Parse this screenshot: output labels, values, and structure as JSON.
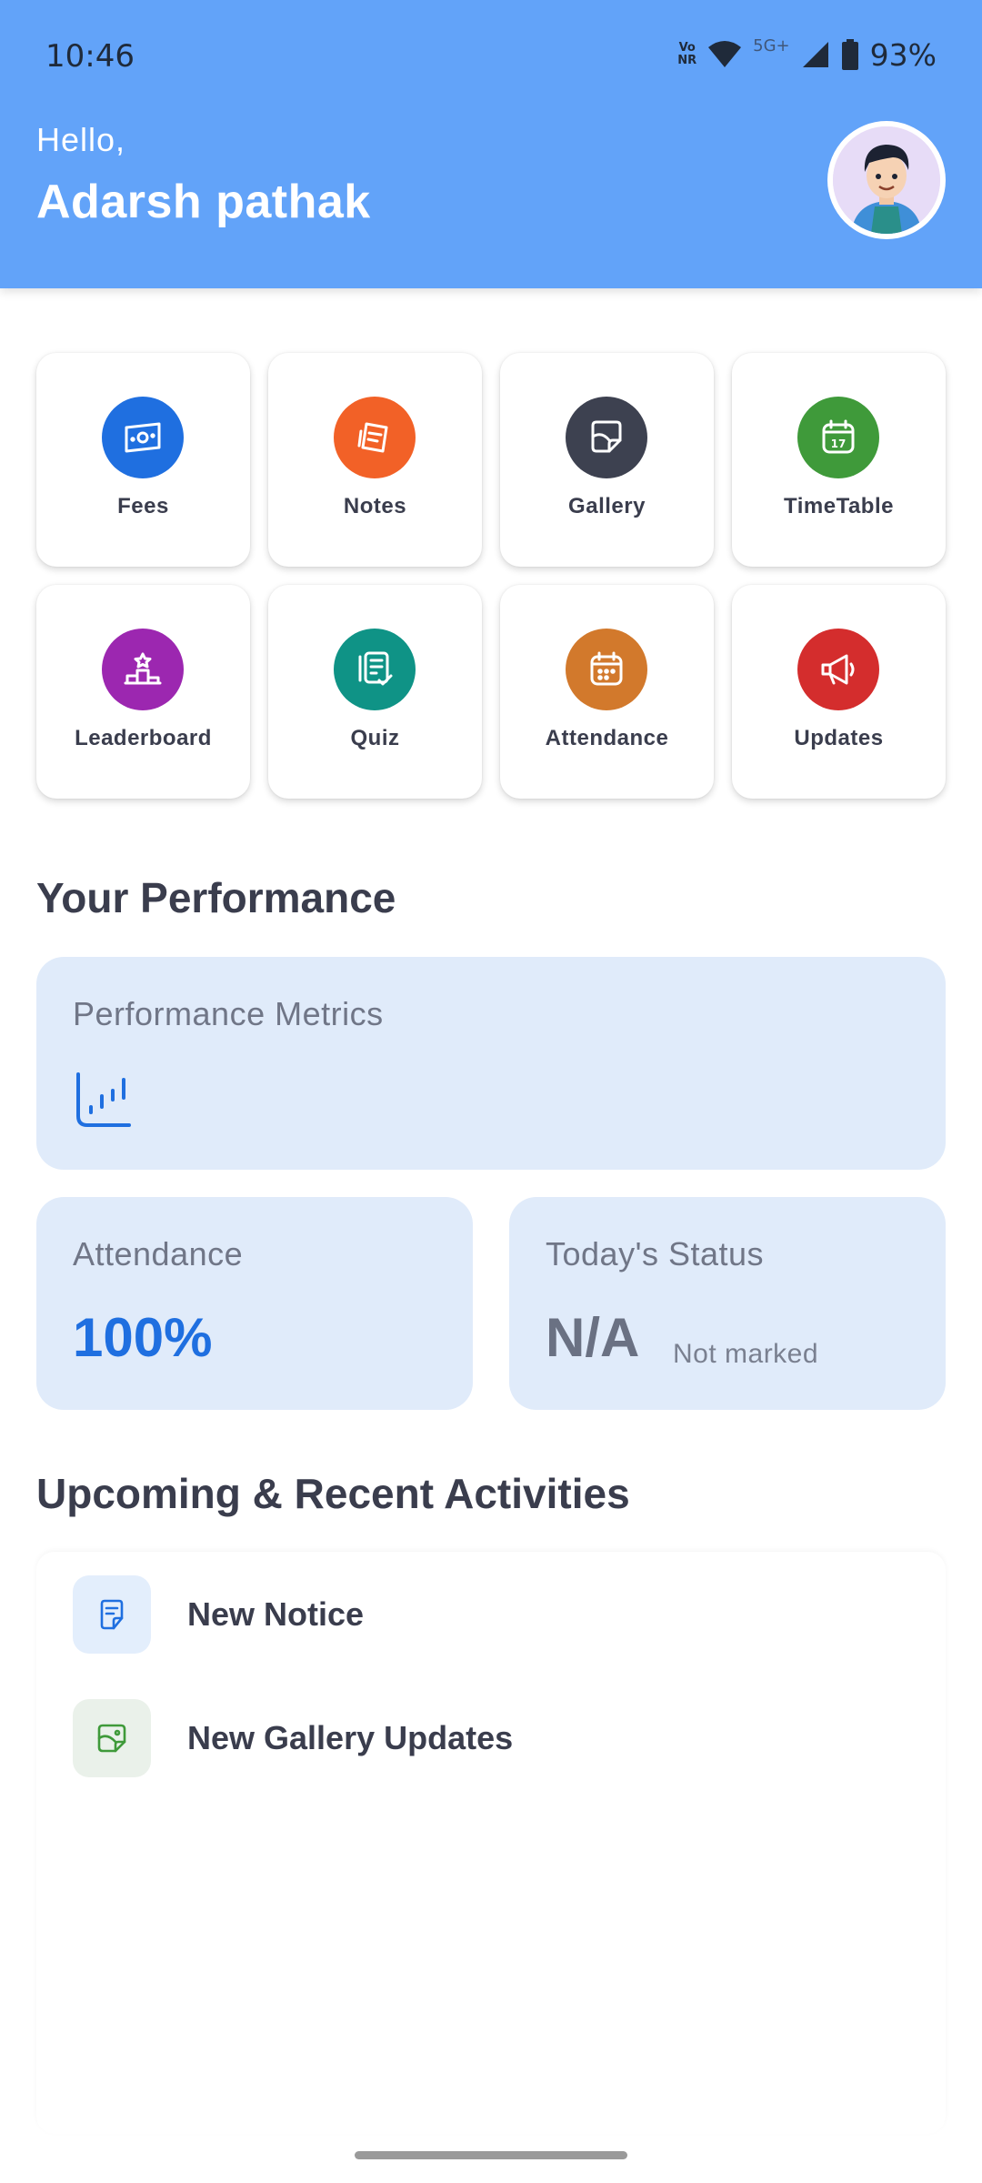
{
  "status_bar": {
    "time": "10:46",
    "volte_label": "Vo\nNR",
    "network_label": "5G+",
    "battery": "93%"
  },
  "header": {
    "greeting": "Hello,",
    "user_name": "Adarsh pathak",
    "avatar_icon": "avatar-icon",
    "background_color": "#62a3f9"
  },
  "menu": {
    "items": [
      {
        "label": "Fees",
        "icon": "money-icon",
        "color": "#1f6fe0"
      },
      {
        "label": "Notes",
        "icon": "notes-icon",
        "color": "#f26127"
      },
      {
        "label": "Gallery",
        "icon": "gallery-icon",
        "color": "#3d4150"
      },
      {
        "label": "TimeTable",
        "icon": "calendar-icon",
        "color": "#3f9a3a"
      },
      {
        "label": "Leaderboard",
        "icon": "podium-icon",
        "color": "#9c27b0"
      },
      {
        "label": "Quiz",
        "icon": "quiz-icon",
        "color": "#0f9386"
      },
      {
        "label": "Attendance",
        "icon": "attendance-icon",
        "color": "#d2792c"
      },
      {
        "label": "Updates",
        "icon": "megaphone-icon",
        "color": "#d42d2d"
      }
    ]
  },
  "performance": {
    "section_title": "Your Performance",
    "metrics_title": "Performance Metrics",
    "attendance_title": "Attendance",
    "attendance_value": "100%",
    "status_title": "Today's Status",
    "status_value": "N/A",
    "status_note": "Not marked",
    "accent_color": "#1f6fe0"
  },
  "activities": {
    "section_title": "Upcoming & Recent Activities",
    "items": [
      {
        "label": "New Notice",
        "icon": "notice-icon"
      },
      {
        "label": "New Gallery Updates",
        "icon": "gallery-update-icon"
      }
    ]
  },
  "calendar_day": "17"
}
